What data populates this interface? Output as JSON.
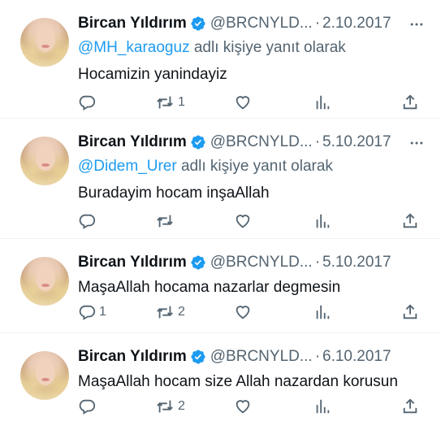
{
  "tweets": [
    {
      "name": "Bircan Yıldırım",
      "handle": "@BRCNYLD...",
      "separator": "·",
      "date": "2.10.2017",
      "reply_mention": "@MH_karaoguz",
      "reply_suffix": " adlı kişiye yanıt olarak",
      "text": "Hocamizin yanindayiz",
      "reply_count": "",
      "retweet_count": "1",
      "like_count": "",
      "views_count": ""
    },
    {
      "name": "Bircan Yıldırım",
      "handle": "@BRCNYLD...",
      "separator": "·",
      "date": "5.10.2017",
      "reply_mention": "@Didem_Urer",
      "reply_suffix": " adlı kişiye yanıt olarak",
      "text": "Buradayim hocam inşaAllah",
      "reply_count": "",
      "retweet_count": "",
      "like_count": "",
      "views_count": ""
    },
    {
      "name": "Bircan Yıldırım",
      "handle": "@BRCNYLD...",
      "separator": "·",
      "date": "5.10.2017",
      "text": "MaşaAllah hocama nazarlar degmesin",
      "reply_count": "1",
      "retweet_count": "2",
      "like_count": "",
      "views_count": ""
    },
    {
      "name": "Bircan Yıldırım",
      "handle": "@BRCNYLD...",
      "separator": "·",
      "date": "6.10.2017",
      "text": "MaşaAllah hocam size Allah nazardan korusun",
      "reply_count": "",
      "retweet_count": "2",
      "like_count": "",
      "views_count": ""
    }
  ],
  "icons": {
    "verified": "verified-badge-icon",
    "more": "more-options-icon",
    "reply": "reply-icon",
    "retweet": "retweet-icon",
    "like": "heart-icon",
    "views": "views-icon",
    "share": "share-icon"
  },
  "colors": {
    "text": "#0f1419",
    "muted": "#536471",
    "accent": "#1d9bf0",
    "divider": "#eff3f4"
  }
}
